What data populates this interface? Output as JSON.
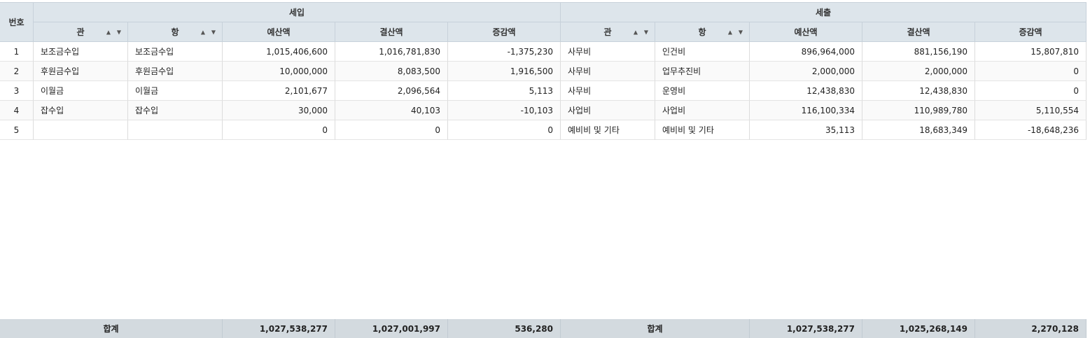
{
  "grid": {
    "row_number_header": "번호",
    "revenue_group": "세입",
    "expense_group": "세출",
    "columns": {
      "rev_gwan": "관",
      "rev_hang": "항",
      "rev_budget": "예산액",
      "rev_settle": "결산액",
      "rev_diff": "증감액",
      "exp_gwan": "관",
      "exp_hang": "항",
      "exp_budget": "예산액",
      "exp_settle": "결산액",
      "exp_diff": "증감액"
    },
    "sort_filter_glyph": "▲ ▼",
    "rows": [
      {
        "no": "1",
        "rev_gwan": "보조금수입",
        "rev_hang": "보조금수입",
        "rev_budget": "1,015,406,600",
        "rev_settle": "1,016,781,830",
        "rev_diff": "-1,375,230",
        "exp_gwan": "사무비",
        "exp_hang": "인건비",
        "exp_budget": "896,964,000",
        "exp_settle": "881,156,190",
        "exp_diff": "15,807,810"
      },
      {
        "no": "2",
        "rev_gwan": "후원금수입",
        "rev_hang": "후원금수입",
        "rev_budget": "10,000,000",
        "rev_settle": "8,083,500",
        "rev_diff": "1,916,500",
        "exp_gwan": "사무비",
        "exp_hang": "업무추진비",
        "exp_budget": "2,000,000",
        "exp_settle": "2,000,000",
        "exp_diff": "0"
      },
      {
        "no": "3",
        "rev_gwan": "이월금",
        "rev_hang": "이월금",
        "rev_budget": "2,101,677",
        "rev_settle": "2,096,564",
        "rev_diff": "5,113",
        "exp_gwan": "사무비",
        "exp_hang": "운영비",
        "exp_budget": "12,438,830",
        "exp_settle": "12,438,830",
        "exp_diff": "0"
      },
      {
        "no": "4",
        "rev_gwan": "잡수입",
        "rev_hang": "잡수입",
        "rev_budget": "30,000",
        "rev_settle": "40,103",
        "rev_diff": "-10,103",
        "exp_gwan": "사업비",
        "exp_hang": " 사업비",
        "exp_budget": "116,100,334",
        "exp_settle": "110,989,780",
        "exp_diff": "5,110,554"
      },
      {
        "no": "5",
        "rev_gwan": "",
        "rev_hang": "",
        "rev_budget": "0",
        "rev_settle": "0",
        "rev_diff": "0",
        "exp_gwan": "예비비 및 기타",
        "exp_hang": "예비비 및 기타",
        "exp_budget": "35,113",
        "exp_settle": "18,683,349",
        "exp_diff": "-18,648,236"
      }
    ],
    "footer": {
      "rev_label": "합계",
      "rev_budget": "1,027,538,277",
      "rev_settle": "1,027,001,997",
      "rev_diff": "536,280",
      "exp_label": "합계",
      "exp_budget": "1,027,538,277",
      "exp_settle": "1,025,268,149",
      "exp_diff": "2,270,128"
    }
  }
}
